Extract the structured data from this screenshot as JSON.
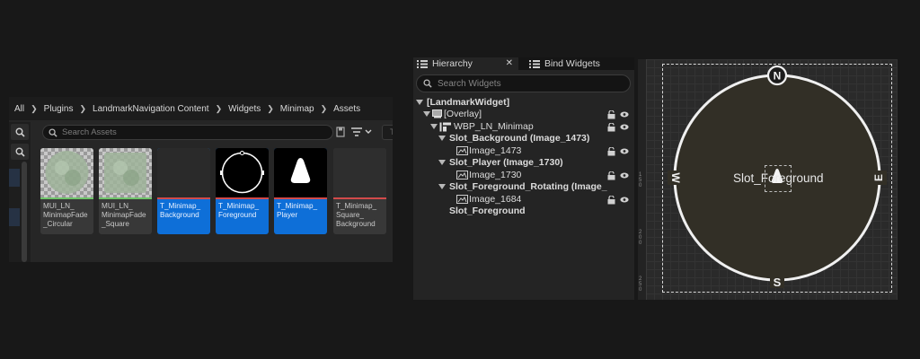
{
  "content_browser": {
    "breadcrumb": [
      "All",
      "Plugins",
      "LandmarkNavigation Content",
      "Widgets",
      "Minimap",
      "Assets"
    ],
    "search_placeholder": "Search Assets",
    "search_right_text": "Te",
    "assets": [
      {
        "name": "MUI_LN_\nMinimapFade\n_Circular",
        "strip_color": "#6fc46a"
      },
      {
        "name": "MUI_LN_\nMinimapFade\n_Square",
        "strip_color": "#6fc46a"
      },
      {
        "name": "T_Minimap_\nBackground",
        "strip_color": "#d24a4a"
      },
      {
        "name": "T_Minimap_\nForeground",
        "strip_color": "#d24a4a"
      },
      {
        "name": "T_Minimap_\nPlayer",
        "strip_color": "#d24a4a"
      },
      {
        "name": "T_Minimap_\nSquare_\nBackground",
        "strip_color": "#d24a4a"
      }
    ]
  },
  "hierarchy": {
    "tab_label": "Hierarchy",
    "tab2_label": "Bind Widgets",
    "search_placeholder": "Search Widgets",
    "rows": [
      {
        "label": "[LandmarkWidget]"
      },
      {
        "label": "[Overlay]"
      },
      {
        "label": "WBP_LN_Minimap"
      },
      {
        "label": "Slot_Background (Image_1473)"
      },
      {
        "label": "Image_1473"
      },
      {
        "label": "Slot_Player (Image_1730)"
      },
      {
        "label": "Image_1730"
      },
      {
        "label": "Slot_Foreground_Rotating (Image_"
      },
      {
        "label": "Image_1684"
      },
      {
        "label": "Slot_Foreground"
      }
    ]
  },
  "canvas": {
    "slot_label": "Slot_Foreground",
    "compass": {
      "north": "N",
      "south": "S",
      "east": "E",
      "west": "W"
    },
    "ruler_marks": [
      "1\n5\n0",
      "2\n0\n0",
      "2\n5\n0"
    ]
  },
  "colors": {
    "selection_blue": "#0e6fd8",
    "material_strip": "#6fc46a",
    "texture_strip": "#d24a4a"
  }
}
